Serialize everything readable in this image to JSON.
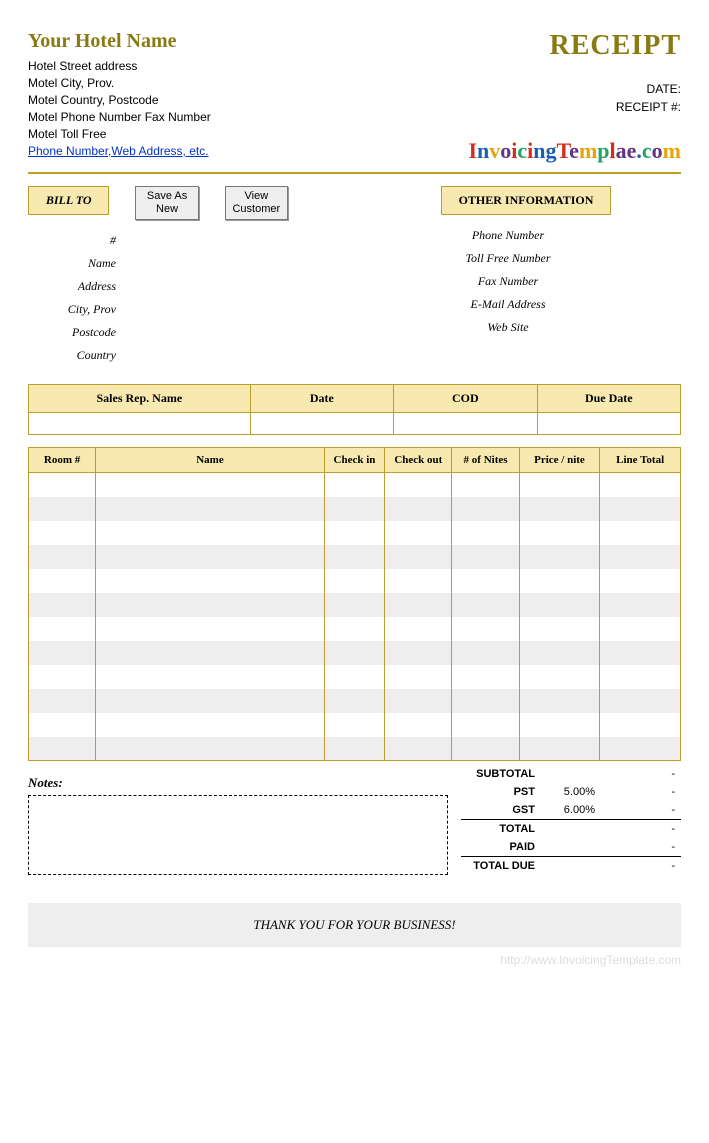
{
  "header": {
    "hotel_name": "Your Hotel Name",
    "street": "Hotel  Street address",
    "city": "Motel City, Prov.",
    "country": "Motel Country, Postcode",
    "phone": "Motel Phone Number   Fax Number",
    "tollfree": "Motel Toll Free",
    "web": "Phone Number,Web Address, etc.",
    "receipt_title": "RECEIPT",
    "date_label": "DATE:",
    "receiptnum_label": "RECEIPT #:"
  },
  "logo": {
    "text": "InvoicingTemplae.com"
  },
  "buttons": {
    "save_as_new": "Save As New",
    "view_customer": "View Customer"
  },
  "billto": {
    "title": "BILL TO",
    "fields": [
      "#",
      "Name",
      "Address",
      "City, Prov",
      "Postcode",
      "Country"
    ]
  },
  "otherinfo": {
    "title": "OTHER INFORMATION",
    "fields": [
      "Phone Number",
      "Toll Free Number",
      "Fax Number",
      "E-Mail Address",
      "Web Site"
    ]
  },
  "meta_table": {
    "cols": [
      "Sales Rep. Name",
      "Date",
      "COD",
      "Due Date"
    ]
  },
  "items_table": {
    "cols": [
      "Room #",
      "Name",
      "Check in",
      "Check out",
      "# of Nites",
      "Price / nite",
      "Line Total"
    ],
    "row_count": 12
  },
  "totals": {
    "subtotal": {
      "label": "SUBTOTAL",
      "value": "-"
    },
    "pst": {
      "label": "PST",
      "pct": "5.00%",
      "value": "-"
    },
    "gst": {
      "label": "GST",
      "pct": "6.00%",
      "value": "-"
    },
    "total": {
      "label": "TOTAL",
      "value": "-"
    },
    "paid": {
      "label": "PAID",
      "value": "-"
    },
    "due": {
      "label": "TOTAL DUE",
      "value": "-"
    }
  },
  "notes": {
    "label": "Notes:"
  },
  "footer": {
    "thanks": "THANK YOU FOR YOUR BUSINESS!"
  },
  "watermark": "http://www.InvoicingTemplate.com"
}
